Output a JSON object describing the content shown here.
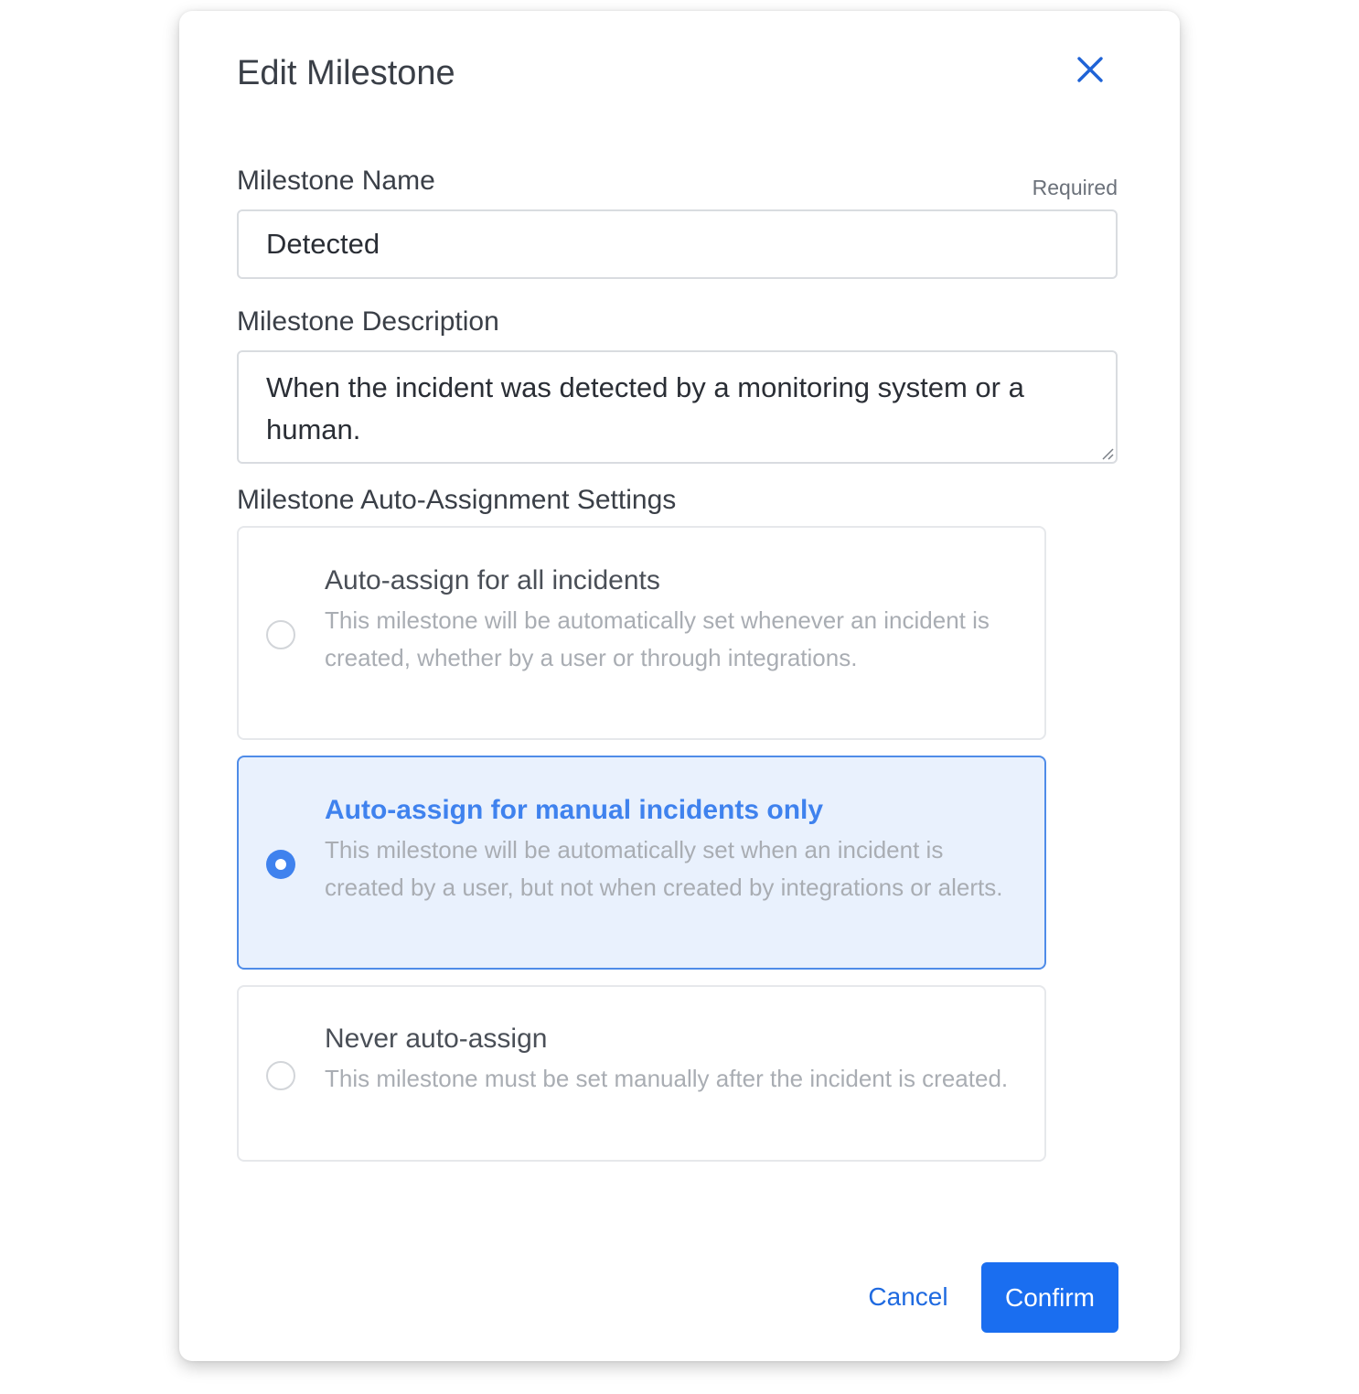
{
  "dialog": {
    "title": "Edit Milestone"
  },
  "name_field": {
    "label": "Milestone Name",
    "required_label": "Required",
    "value": "Detected"
  },
  "description_field": {
    "label": "Milestone Description",
    "value": "When the incident was detected by a monitoring system or a human."
  },
  "auto_assignment": {
    "label": "Milestone Auto-Assignment Settings",
    "selected_index": 1,
    "options": [
      {
        "title": "Auto-assign for all incidents",
        "description": "This milestone will be automatically set whenever an incident is created, whether by a user or through integrations."
      },
      {
        "title": "Auto-assign for manual incidents only",
        "description": "This milestone will be automatically set when an incident is created by a user, but not when created by integrations or alerts."
      },
      {
        "title": "Never auto-assign",
        "description": "This milestone must be set manually after the incident is created."
      }
    ]
  },
  "actions": {
    "cancel_label": "Cancel",
    "confirm_label": "Confirm"
  },
  "colors": {
    "primary": "#1a6ef0",
    "selected_background": "#e9f1fd",
    "selected_text": "#3f82ee"
  },
  "icons": {
    "close": "close-icon",
    "resize": "resize-handle-icon"
  }
}
